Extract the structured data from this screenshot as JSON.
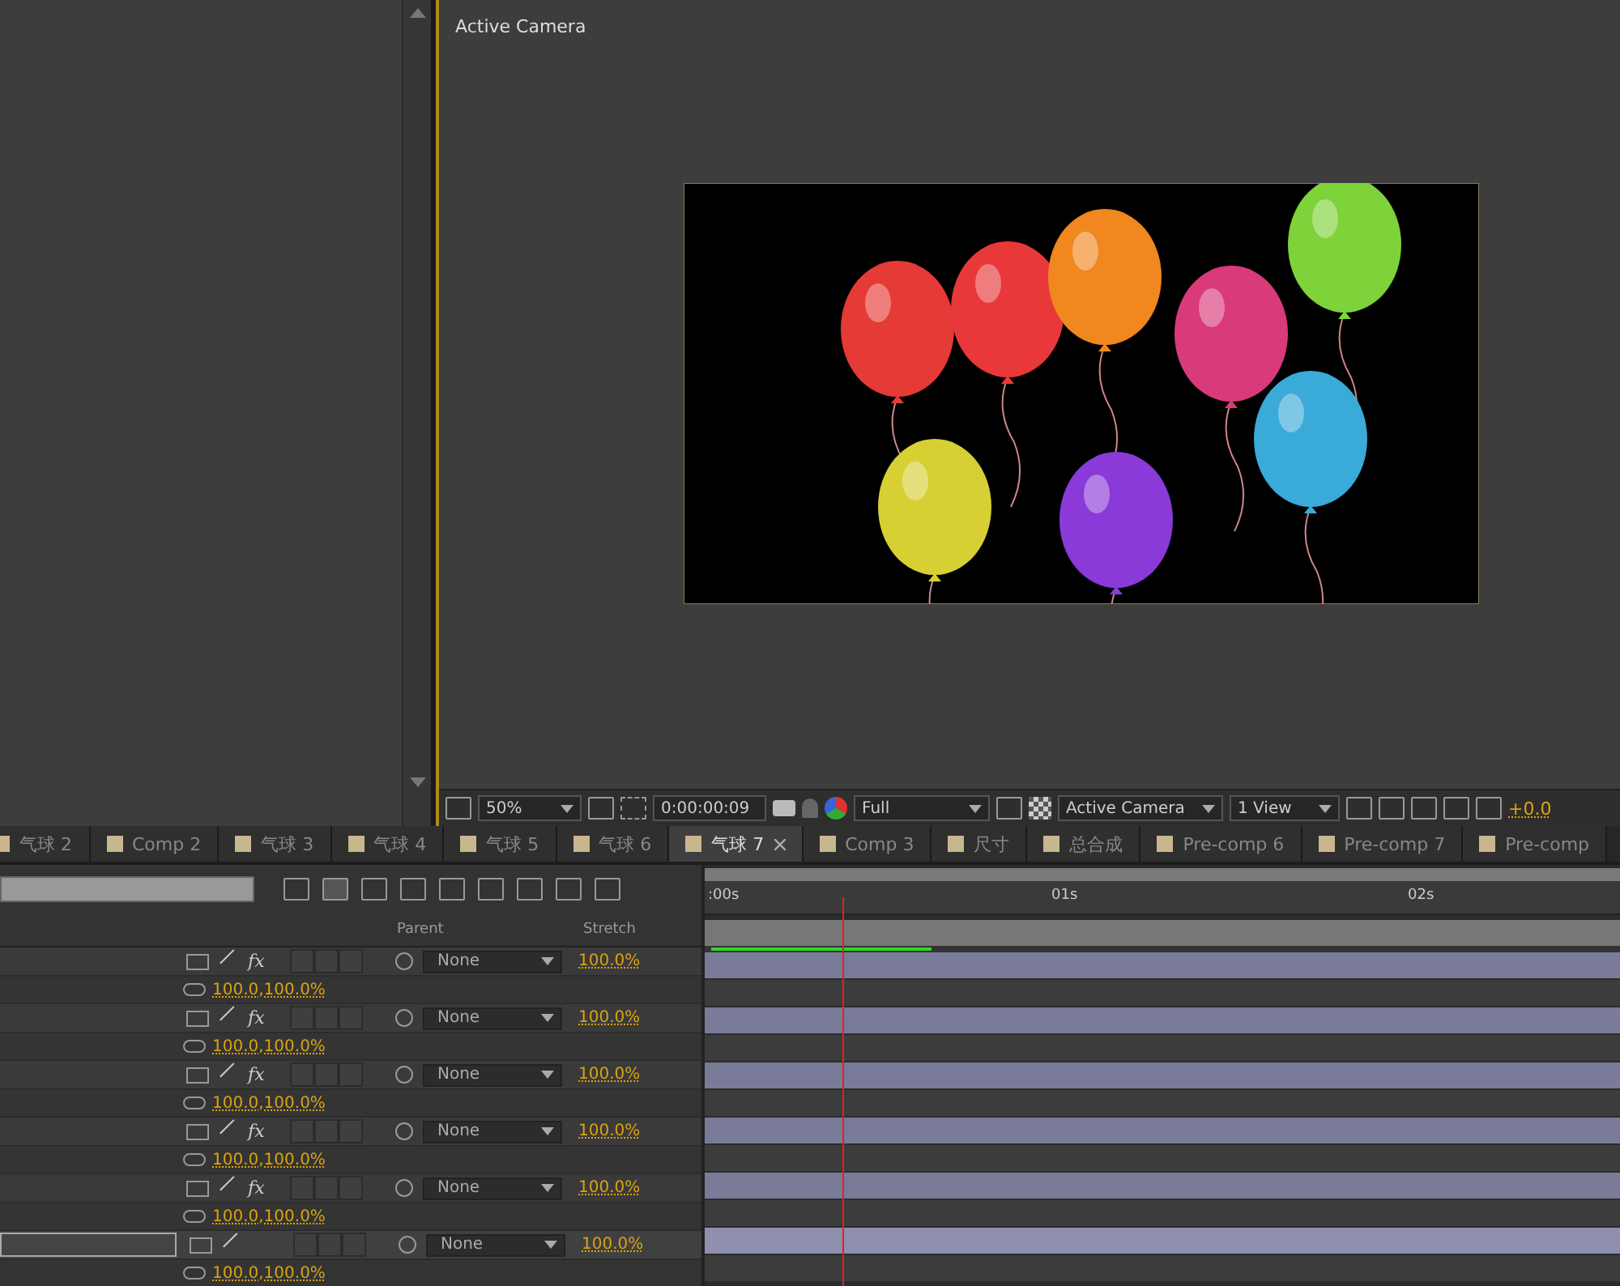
{
  "viewer": {
    "label": "Active Camera",
    "toolbar": {
      "zoom": "50%",
      "timecode": "0:00:00:09",
      "resolution": "Full",
      "camera": "Active Camera",
      "views": "1 View",
      "exposure": "+0.0"
    }
  },
  "tabs": [
    {
      "label": "气球 2",
      "selected": false
    },
    {
      "label": "Comp 2",
      "selected": false
    },
    {
      "label": "气球 3",
      "selected": false
    },
    {
      "label": "气球 4",
      "selected": false
    },
    {
      "label": "气球 5",
      "selected": false
    },
    {
      "label": "气球 6",
      "selected": false
    },
    {
      "label": "气球 7",
      "selected": true
    },
    {
      "label": "Comp 3",
      "selected": false
    },
    {
      "label": "尺寸",
      "selected": false
    },
    {
      "label": "总合成",
      "selected": false
    },
    {
      "label": "Pre-comp 6",
      "selected": false
    },
    {
      "label": "Pre-comp 7",
      "selected": false
    },
    {
      "label": "Pre-comp",
      "selected": false
    }
  ],
  "timeline": {
    "columns": [
      "Parent",
      "Stretch"
    ],
    "ruler": [
      ":00s",
      "01s",
      "02s"
    ],
    "layers": [
      {
        "fx": "fx",
        "selected": false,
        "parent": "None",
        "stretch": "100.0%",
        "scale": "100.0,100.0%"
      },
      {
        "fx": "fx",
        "selected": false,
        "parent": "None",
        "stretch": "100.0%",
        "scale": "100.0,100.0%"
      },
      {
        "fx": "fx",
        "selected": false,
        "parent": "None",
        "stretch": "100.0%",
        "scale": "100.0,100.0%"
      },
      {
        "fx": "fx",
        "selected": false,
        "parent": "None",
        "stretch": "100.0%",
        "scale": "100.0,100.0%"
      },
      {
        "fx": "fx",
        "selected": false,
        "parent": "None",
        "stretch": "100.0%",
        "scale": "100.0,100.0%"
      },
      {
        "selected": true,
        "parent": "None",
        "stretch": "100.0%",
        "scale": "100.0,100.0%"
      }
    ]
  }
}
